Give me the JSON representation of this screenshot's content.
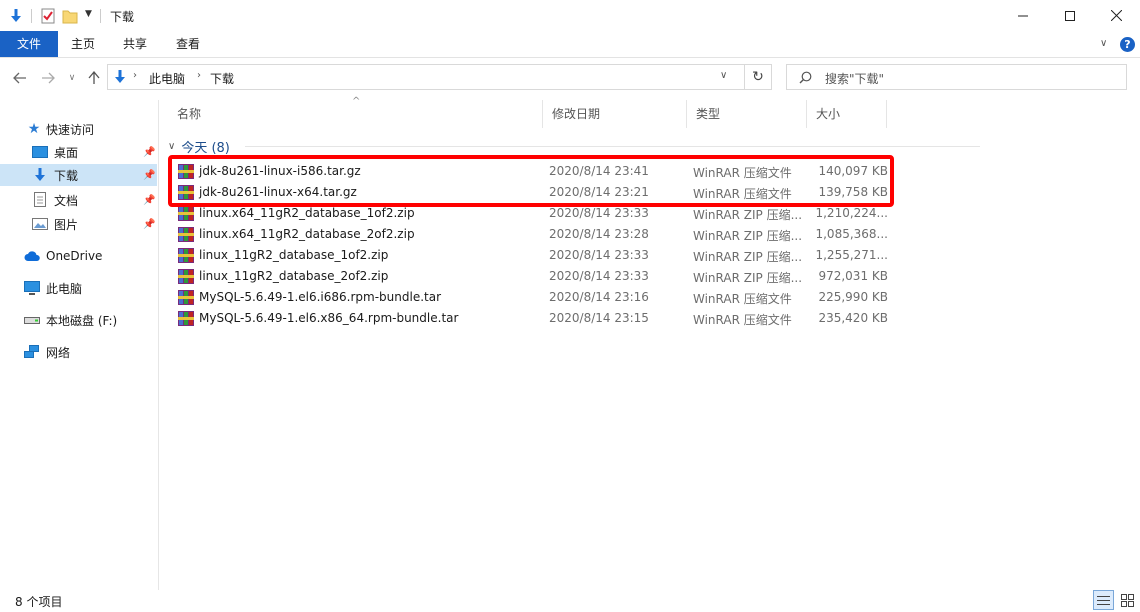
{
  "window": {
    "title": "下载"
  },
  "ribbon": {
    "tabs": [
      "文件",
      "主页",
      "共享",
      "查看"
    ],
    "active_tab": "文件"
  },
  "address": {
    "segments": [
      "此电脑",
      "下载"
    ],
    "search_placeholder": "搜索\"下载\""
  },
  "nav_pane": {
    "quick_access": "快速访问",
    "items": [
      {
        "label": "桌面",
        "pinned": true
      },
      {
        "label": "下载",
        "pinned": true,
        "selected": true
      },
      {
        "label": "文档",
        "pinned": true
      },
      {
        "label": "图片",
        "pinned": true
      }
    ],
    "onedrive": "OneDrive",
    "this_pc": "此电脑",
    "local_disk": "本地磁盘 (F:)",
    "network": "网络"
  },
  "columns": [
    "名称",
    "修改日期",
    "类型",
    "大小"
  ],
  "group": {
    "label": "今天 (8)"
  },
  "files": [
    {
      "name": "jdk-8u261-linux-i586.tar.gz",
      "date": "2020/8/14 23:41",
      "type": "WinRAR 压缩文件",
      "size": "140,097 KB"
    },
    {
      "name": "jdk-8u261-linux-x64.tar.gz",
      "date": "2020/8/14 23:21",
      "type": "WinRAR 压缩文件",
      "size": "139,758 KB"
    },
    {
      "name": "linux.x64_11gR2_database_1of2.zip",
      "date": "2020/8/14 23:33",
      "type": "WinRAR ZIP 压缩...",
      "size": "1,210,224..."
    },
    {
      "name": "linux.x64_11gR2_database_2of2.zip",
      "date": "2020/8/14 23:28",
      "type": "WinRAR ZIP 压缩...",
      "size": "1,085,368..."
    },
    {
      "name": "linux_11gR2_database_1of2.zip",
      "date": "2020/8/14 23:33",
      "type": "WinRAR ZIP 压缩...",
      "size": "1,255,271..."
    },
    {
      "name": "linux_11gR2_database_2of2.zip",
      "date": "2020/8/14 23:33",
      "type": "WinRAR ZIP 压缩...",
      "size": "972,031 KB"
    },
    {
      "name": "MySQL-5.6.49-1.el6.i686.rpm-bundle.tar",
      "date": "2020/8/14 23:16",
      "type": "WinRAR 压缩文件",
      "size": "225,990 KB"
    },
    {
      "name": "MySQL-5.6.49-1.el6.x86_64.rpm-bundle.tar",
      "date": "2020/8/14 23:15",
      "type": "WinRAR 压缩文件",
      "size": "235,420 KB"
    }
  ],
  "status": {
    "count": "8 个项目"
  },
  "colors": {
    "accent": "#1a62c5",
    "highlight": "#ff0000",
    "selection": "#cce4f7"
  }
}
